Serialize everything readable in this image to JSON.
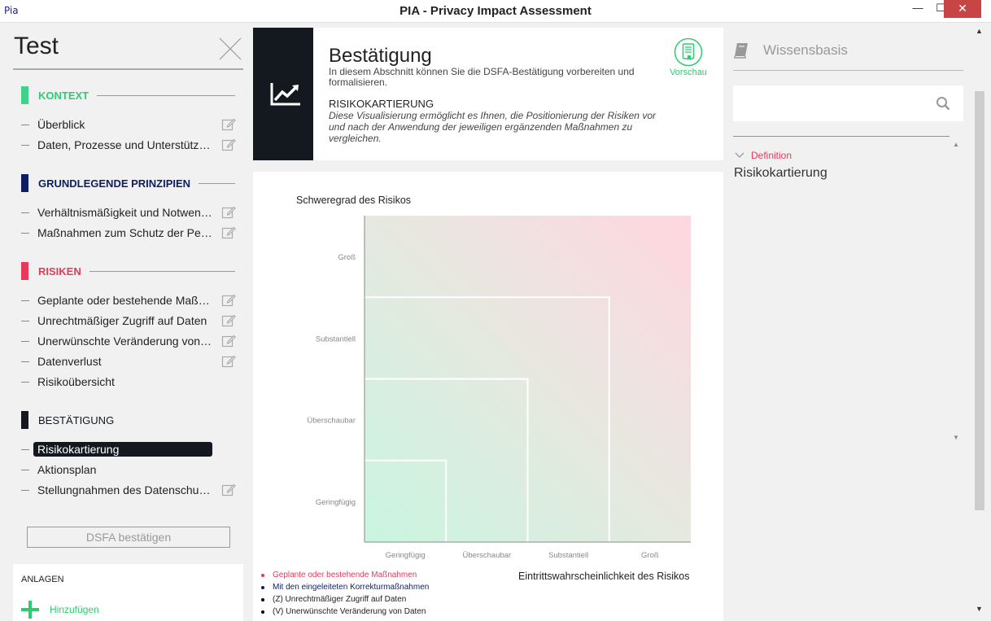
{
  "window": {
    "logo": "Pia",
    "title": "PIA - Privacy Impact Assessment",
    "min_label": "—",
    "max_label": "☐",
    "close_label": "✕"
  },
  "sidebar": {
    "pia_name": "Test",
    "sections": [
      {
        "label": "KONTEXT",
        "color": "#3fd28b",
        "label_color": "#2ecc71"
      },
      {
        "label": "GRUNDLEGENDE PRINZIPIEN",
        "color": "#0e1e63",
        "label_color": "#0e1e63"
      },
      {
        "label": "RISIKEN",
        "color": "#e8395b",
        "label_color": "#e8395b"
      },
      {
        "label": "BESTÄTIGUNG",
        "color": "#14191f",
        "label_color": "#14191f"
      }
    ],
    "items": [
      "Überblick",
      "Daten, Prozesse und Unterstützungsanlagen",
      "Verhältnismäßigkeit und Notwendigkeit",
      "Maßnahmen zum Schutz der Personenrechte",
      "Geplante oder bestehende Maßnahmen",
      "Unrechtmäßiger Zugriff auf Daten",
      "Unerwünschte Veränderung von Daten",
      "Datenverlust",
      "Risikoübersicht",
      "Risikokartierung",
      "Aktionsplan",
      "Stellungnahmen des Datenschutzbeauftragten"
    ],
    "confirm_button": "DSFA bestätigen",
    "attachments": {
      "title": "ANLAGEN",
      "add_label": "Hinzufügen"
    }
  },
  "header": {
    "title": "Bestätigung",
    "description": "In diesem Abschnitt können Sie die DSFA-Bestätigung vorbereiten und formalisieren.",
    "subtitle": "RISIKOKARTIERUNG",
    "subdescription": "Diese Visualisierung ermöglicht es Ihnen, die Positionierung der Risiken vor und nach der Anwendung der jeweiligen ergänzenden Maßnahmen zu vergleichen.",
    "preview_label": "Vorschau"
  },
  "chart_data": {
    "type": "heatmap",
    "ylabel": "Schweregrad des Risikos",
    "xlabel": "Eintrittswahrscheinlichkeit des Risikos",
    "x_categories": [
      "Geringfügig",
      "Überschaubar",
      "Substantiell",
      "Groß"
    ],
    "y_categories": [
      "Geringfügig",
      "Überschaubar",
      "Substantiell",
      "Groß"
    ],
    "legend": [
      {
        "label": "Geplante oder bestehende Maßnahmen",
        "color": "#e8395b"
      },
      {
        "label": "Mit den eingeleiteten Korrekturmaßnahmen",
        "color": "#0e1e63"
      },
      {
        "label": "(Z) Unrechtmäßiger Zugriff auf Daten",
        "color": "#000000"
      },
      {
        "label": "(V) Unerwünschte Veränderung von Daten",
        "color": "#000000"
      }
    ],
    "colors": {
      "low": "#c8f5df",
      "high": "#ffd6df"
    }
  },
  "knowledge_base": {
    "title": "Wissensbasis",
    "search_placeholder": "",
    "definition_label": "Definition",
    "definition_value": "Risikokartierung"
  }
}
